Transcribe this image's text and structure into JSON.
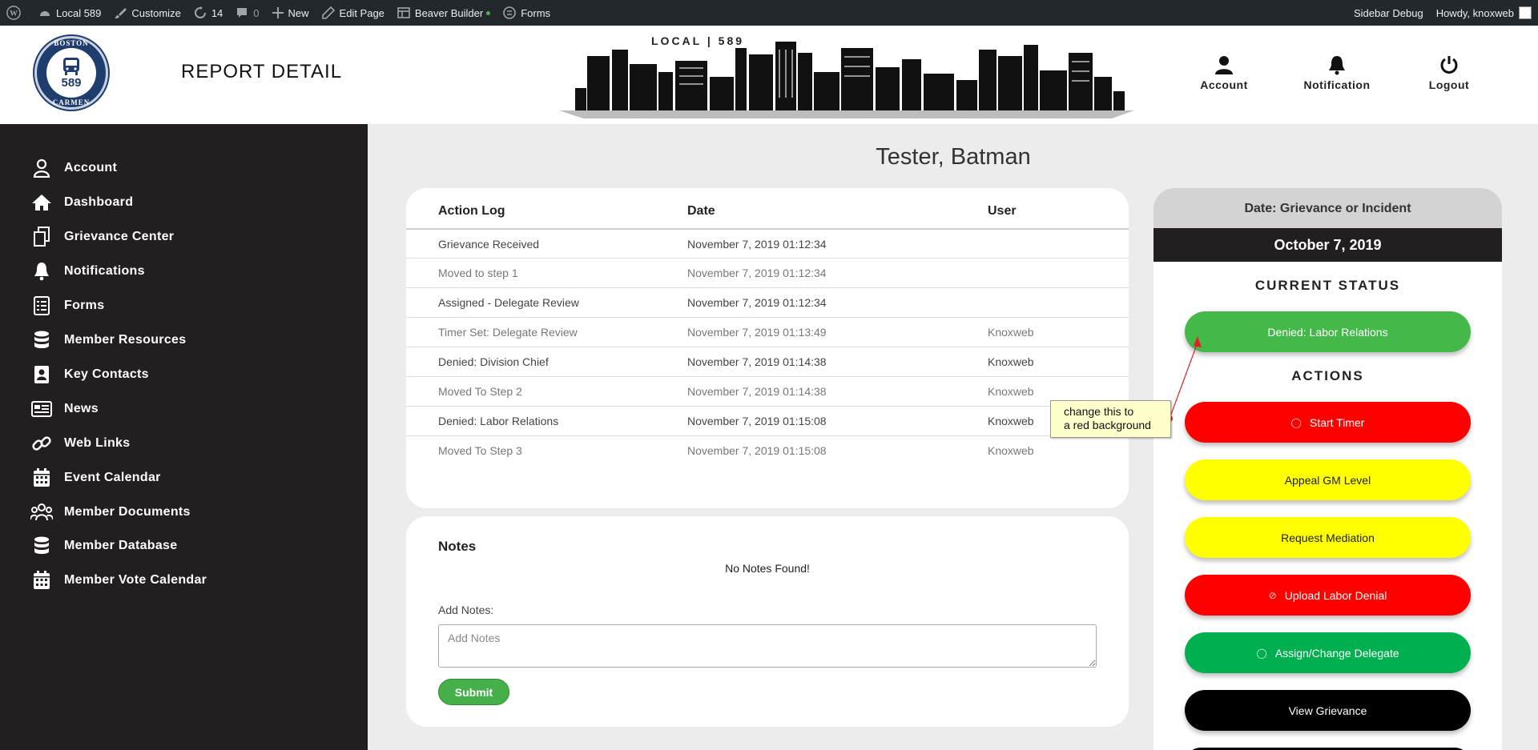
{
  "admin_bar": {
    "site_name": "Local 589",
    "customize": "Customize",
    "updates": "14",
    "comments": "0",
    "new": "New",
    "edit_page": "Edit Page",
    "beaver_builder": "Beaver Builder",
    "forms": "Forms",
    "sidebar_debug": "Sidebar Debug",
    "howdy": "Howdy, knoxweb"
  },
  "header": {
    "logo_top_text": "BOSTON",
    "logo_number": "589",
    "logo_bottom_text": "CARMEN",
    "page_title": "REPORT DETAIL",
    "skyline_text": "LOCAL  |  589",
    "account_label": "Account",
    "notification_label": "Notification",
    "logout_label": "Logout"
  },
  "sidebar": {
    "items": [
      {
        "label": "Account",
        "icon": "user-icon"
      },
      {
        "label": "Dashboard",
        "icon": "home-icon"
      },
      {
        "label": "Grievance Center",
        "icon": "copy-icon"
      },
      {
        "label": "Notifications",
        "icon": "bell-icon"
      },
      {
        "label": "Forms",
        "icon": "form-icon"
      },
      {
        "label": "Member Resources",
        "icon": "database-icon"
      },
      {
        "label": "Key Contacts",
        "icon": "contact-book-icon"
      },
      {
        "label": "News",
        "icon": "newspaper-icon"
      },
      {
        "label": "Web Links",
        "icon": "link-icon"
      },
      {
        "label": "Event Calendar",
        "icon": "calendar-icon"
      },
      {
        "label": "Member Documents",
        "icon": "users-icon"
      },
      {
        "label": "Member Database",
        "icon": "database-icon"
      },
      {
        "label": "Member Vote Calendar",
        "icon": "calendar-icon"
      }
    ]
  },
  "main": {
    "person_name": "Tester, Batman",
    "action_log": {
      "headers": [
        "Action Log",
        "Date",
        "User"
      ],
      "rows": [
        [
          "Grievance Received",
          "November 7, 2019 01:12:34",
          ""
        ],
        [
          "Moved to step 1",
          "November 7, 2019 01:12:34",
          ""
        ],
        [
          "Assigned - Delegate Review",
          "November 7, 2019 01:12:34",
          ""
        ],
        [
          "Timer Set: Delegate Review",
          "November 7, 2019 01:13:49",
          "Knoxweb"
        ],
        [
          "Denied: Division Chief",
          "November 7, 2019 01:14:38",
          "Knoxweb"
        ],
        [
          "Moved To Step 2",
          "November 7, 2019 01:14:38",
          "Knoxweb"
        ],
        [
          "Denied: Labor Relations",
          "November 7, 2019 01:15:08",
          "Knoxweb"
        ],
        [
          "Moved To Step 3",
          "November 7, 2019 01:15:08",
          "Knoxweb"
        ]
      ]
    },
    "notes": {
      "title": "Notes",
      "empty_text": "No Notes Found!",
      "add_label": "Add Notes:",
      "placeholder": "Add Notes",
      "submit_label": "Submit"
    }
  },
  "status_panel": {
    "date_heading": "Date: Grievance or Incident",
    "date_value": "October 7, 2019",
    "current_status_title": "CURRENT STATUS",
    "current_status": "Denied: Labor Relations",
    "actions_title": "ACTIONS",
    "actions": [
      {
        "label": "Start Timer",
        "color": "#ff0000",
        "text_color": "#ffffff",
        "icon": "timer-icon"
      },
      {
        "label": "Appeal GM Level",
        "color": "#ffff00",
        "text_color": "#222222",
        "icon": ""
      },
      {
        "label": "Request Mediation",
        "color": "#ffff00",
        "text_color": "#222222",
        "icon": ""
      },
      {
        "label": "Upload Labor Denial",
        "color": "#ff0000",
        "text_color": "#ffffff",
        "icon": "ban-icon"
      },
      {
        "label": "Assign/Change Delegate",
        "color": "#00b050",
        "text_color": "#ffffff",
        "icon": "spinner-icon"
      },
      {
        "label": "View Grievance",
        "color": "#000000",
        "text_color": "#ffffff",
        "icon": ""
      }
    ],
    "status_color": "#45b84a"
  },
  "annotation": {
    "line1": "change this to",
    "line2": "a red background"
  }
}
